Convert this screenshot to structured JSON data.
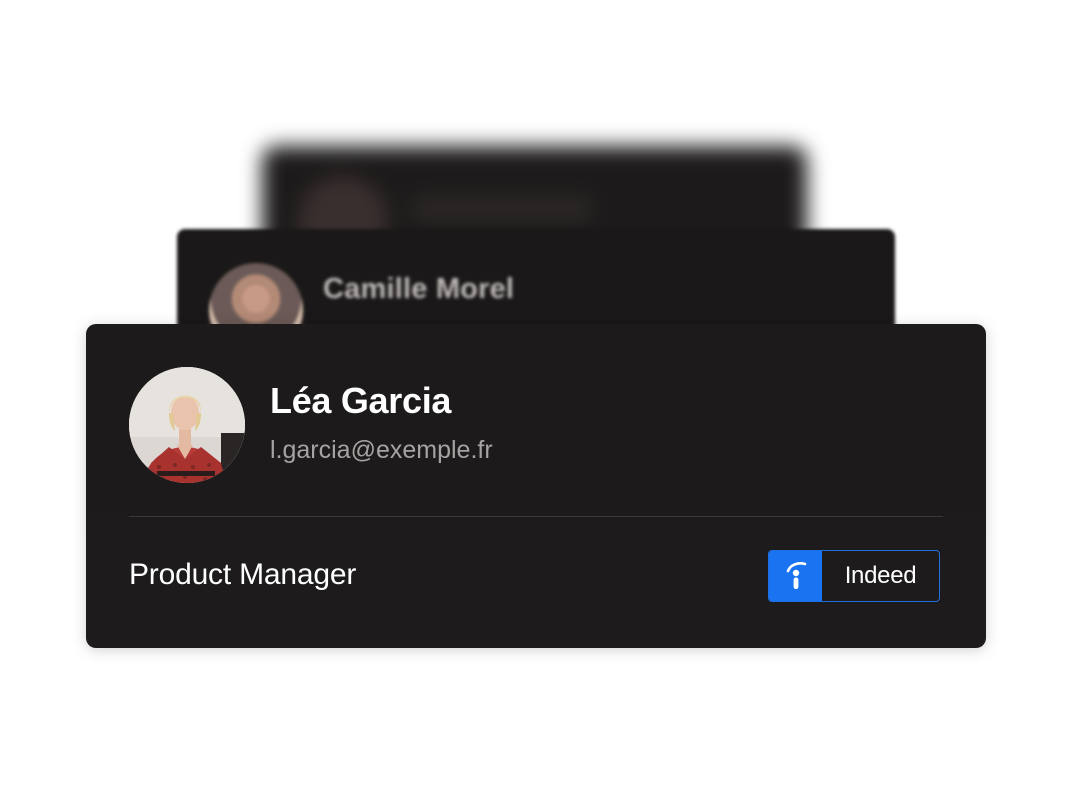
{
  "background_cards": [
    {
      "name": ""
    },
    {
      "name": "Camille Morel"
    }
  ],
  "profile": {
    "name": "Léa Garcia",
    "email": "l.garcia@exemple.fr",
    "role": "Product Manager",
    "avatar_icon": "profile-photo",
    "source": {
      "label": "Indeed",
      "icon": "indeed-icon",
      "color": "#1a73f0"
    }
  },
  "colors": {
    "card_background": "#1c1a1a",
    "name_text": "#ffffff",
    "email_text": "#a6a3a2",
    "divider": "#3a3838",
    "accent": "#1a73f0"
  }
}
